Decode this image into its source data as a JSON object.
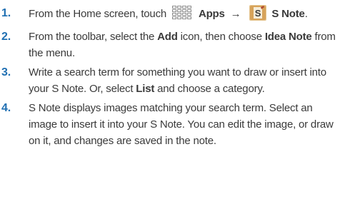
{
  "steps": [
    {
      "number": "1.",
      "pre": "From the Home screen, touch",
      "apps_label": "Apps",
      "arrow": "→",
      "snote_label": "S Note",
      "post": "."
    },
    {
      "number": "2.",
      "pre": "From the toolbar, select the ",
      "bold1": "Add",
      "mid": " icon, then choose ",
      "bold2": "Idea Note",
      "post": " from the menu."
    },
    {
      "number": "3.",
      "pre": "Write a search term for something you want to draw or insert into your S Note. Or, select ",
      "bold1": "List",
      "post": " and choose a category."
    },
    {
      "number": "4.",
      "text": "S Note displays images matching your search term. Select an image to insert it into your S Note. You can edit the image, or draw on it, and changes are saved in the note."
    }
  ],
  "icons": {
    "apps": "apps-grid-icon",
    "snote": "s-note-icon"
  },
  "colors": {
    "step_number": "#1f6fb2",
    "text": "#3a3a3a",
    "snote_icon_bg": "#d7a35a"
  }
}
